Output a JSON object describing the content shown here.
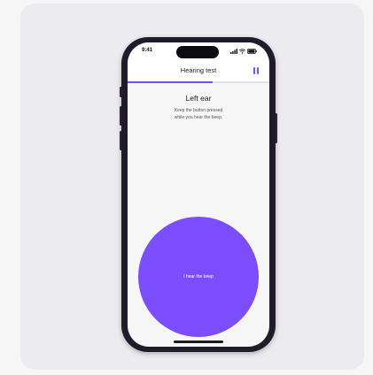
{
  "status_bar": {
    "time": "9:41"
  },
  "nav": {
    "title": "Hearing test"
  },
  "progress": {
    "value": 0.6
  },
  "content": {
    "ear_title": "Left ear",
    "instruction_line1": "Keep the button pressed",
    "instruction_line2": "while you hear the beep."
  },
  "beep_button": {
    "label": "I hear the beep"
  },
  "colors": {
    "accent": "#7c4dff",
    "card_background": "#ecebf0",
    "screen_background": "#f6f6f7"
  },
  "icons": {
    "signal": "cellular-signal-icon",
    "wifi": "wifi-icon",
    "battery": "battery-icon",
    "pause": "pause-icon"
  }
}
